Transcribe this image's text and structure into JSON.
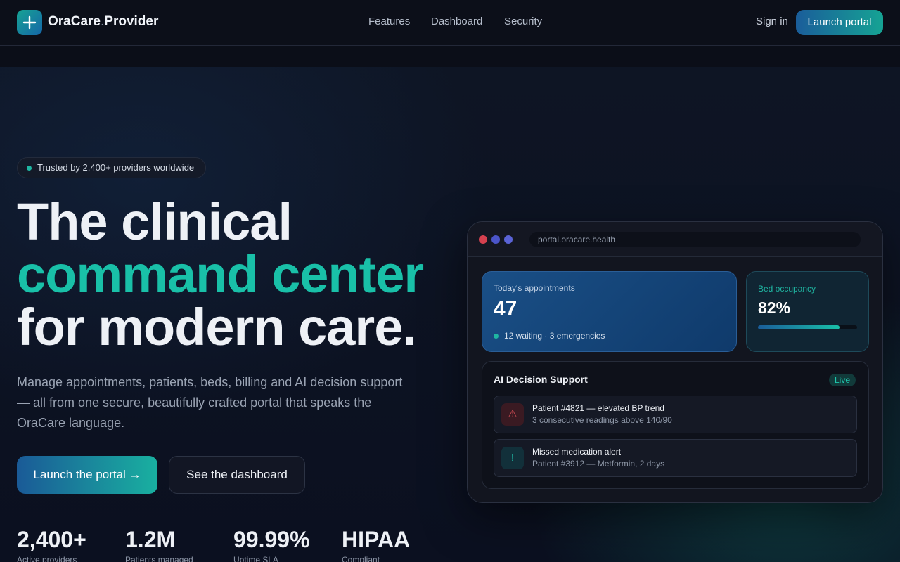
{
  "header": {
    "brand_name": "OraCare",
    "brand_dot": ".",
    "brand_suffix": "Provider",
    "nav": [
      "Features",
      "Dashboard",
      "Security"
    ],
    "sign_in": "Sign in",
    "launch": "Launch portal"
  },
  "hero": {
    "badge": "Trusted by 2,400+ providers worldwide",
    "line1": "The clinical",
    "line2": "command center",
    "line3": "for modern care.",
    "lead": "Manage appointments, patients, beds, billing and AI decision support — all from one secure, beautifully crafted portal that speaks the OraCare language.",
    "primary_cta": "Launch the portal →",
    "secondary_cta": "See the dashboard"
  },
  "stats": [
    {
      "value": "2,400+",
      "label": "Active providers"
    },
    {
      "value": "1.2M",
      "label": "Patients managed"
    },
    {
      "value": "99.99%",
      "label": "Uptime SLA"
    },
    {
      "value": "HIPAA",
      "label": "Compliant"
    }
  ],
  "preview": {
    "url": "portal.oracare.health",
    "appointments": {
      "title": "Today's appointments",
      "value": "47",
      "sub": "12 waiting · 3 emergencies"
    },
    "beds": {
      "title": "Bed occupancy",
      "value": "82%",
      "fill_fraction": 0.82
    },
    "ai": {
      "title": "AI Decision Support",
      "live": "Live",
      "alerts": [
        {
          "title": "Patient #4821 — elevated BP trend",
          "sub": "3 consecutive readings above 140/90",
          "icon": "warning-icon",
          "glyph": "⚠"
        },
        {
          "title": "Missed medication alert",
          "sub": "Patient #3912 — Metformin, 2 days",
          "icon": "exclamation-icon",
          "glyph": "!"
        }
      ]
    }
  },
  "colors": {
    "accent_teal": "#19c0a8",
    "accent_blue": "#1a5d9a",
    "dot_red": "#d5414f",
    "dot_blue": "#4b55c9",
    "dot_indigo": "#5a63d6",
    "alert_red": "#e0525a",
    "alert_teal": "#1fb6a2"
  }
}
